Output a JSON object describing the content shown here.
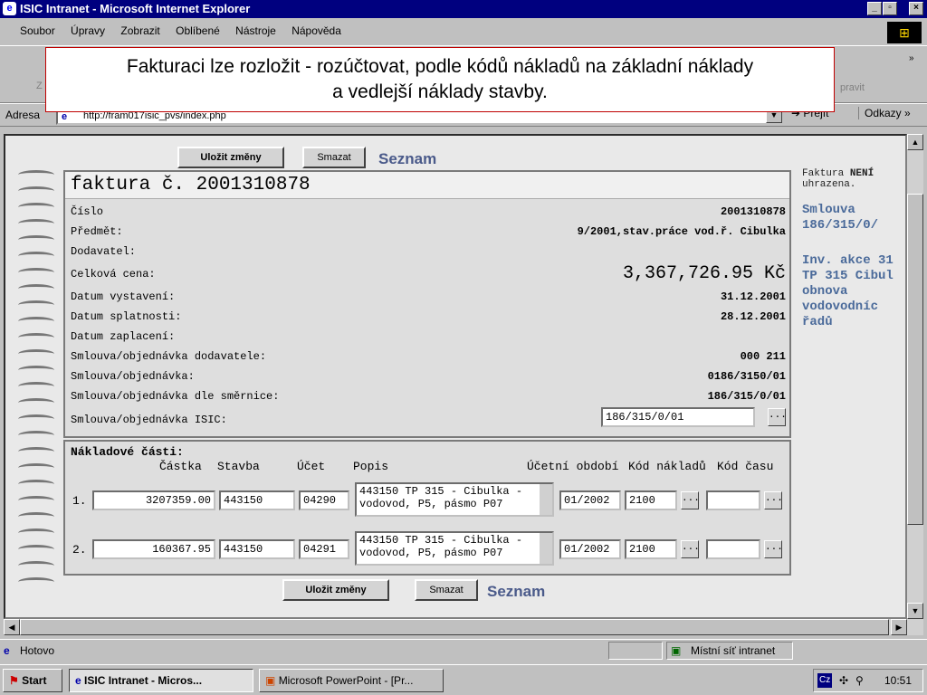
{
  "window": {
    "title": "ISIC Intranet - Microsoft Internet Explorer"
  },
  "menu": [
    "Soubor",
    "Úpravy",
    "Zobrazit",
    "Oblíbené",
    "Nástroje",
    "Nápověda"
  ],
  "toolbar": {
    "ghost_left": "Z",
    "ghost_right": "pravit"
  },
  "address": {
    "label": "Adresa",
    "url": "http://fram017isic_pvs/index.php",
    "go": "Přejít",
    "links": "Odkazy"
  },
  "callout": {
    "line1": "Fakturaci lze rozložit - rozúčtovat, podle kódů nákladů na základní náklady",
    "line2": "a vedlejší náklady stavby."
  },
  "actions": {
    "save": "Uložit změny",
    "delete": "Smazat",
    "list": "Seznam"
  },
  "invoice": {
    "title": "faktura č. 2001310878",
    "fields": [
      {
        "label": "Číslo",
        "value": "2001310878"
      },
      {
        "label": "Předmět:",
        "value": "9/2001,stav.práce vod.ř. Cibulka"
      },
      {
        "label": "Dodavatel:",
        "value": ""
      },
      {
        "label": "Celková cena:",
        "value": "3,367,726.95 Kč"
      },
      {
        "label": "Datum vystavení:",
        "value": "31.12.2001"
      },
      {
        "label": "Datum splatnosti:",
        "value": "28.12.2001"
      },
      {
        "label": "Datum zaplacení:",
        "value": ""
      },
      {
        "label": "Smlouva/objednávka dodavatele:",
        "value": "000 211"
      },
      {
        "label": "Smlouva/objednávka:",
        "value": "0186/3150/01"
      },
      {
        "label": "Smlouva/objednávka dle směrnice:",
        "value": "186/315/0/01"
      },
      {
        "label": "Smlouva/objednávka ISIC:",
        "value": "186/315/0/01"
      }
    ]
  },
  "costs": {
    "title": "Nákladové části:",
    "headers": [
      "Částka",
      "Stavba",
      "Účet",
      "Popis",
      "Účetní období",
      "Kód nákladů",
      "Kód času"
    ],
    "rows": [
      {
        "num": "1.",
        "amount": "3207359.00",
        "stavba": "443150",
        "ucet": "04290",
        "popis1": "443150 TP 315 - Cibulka -",
        "popis2": "vodovod, P5, pásmo P07",
        "obdobi": "01/2002",
        "kod": "2100",
        "cas": ""
      },
      {
        "num": "2.",
        "amount": "160367.95",
        "stavba": "443150",
        "ucet": "04291",
        "popis1": "443150 TP 315 - Cibulka -",
        "popis2": "vodovod, P5, pásmo P07",
        "obdobi": "01/2002",
        "kod": "2100",
        "cas": ""
      }
    ]
  },
  "sidebar": {
    "status_pre": "Faktura ",
    "status_bold": "NENÍ",
    "status_post": "uhrazena.",
    "contract": "Smlouva 186/315/0/",
    "action": "Inv. akce 31 TP 315 Cibul obnova vodovodníc řadů"
  },
  "status": {
    "text": "Hotovo",
    "zone": "Místní síť intranet"
  },
  "taskbar": {
    "start": "Start",
    "task1": "ISIC Intranet - Micros...",
    "task2": "Microsoft PowerPoint - [Pr...",
    "lang": "Cz",
    "time": "10:51"
  }
}
